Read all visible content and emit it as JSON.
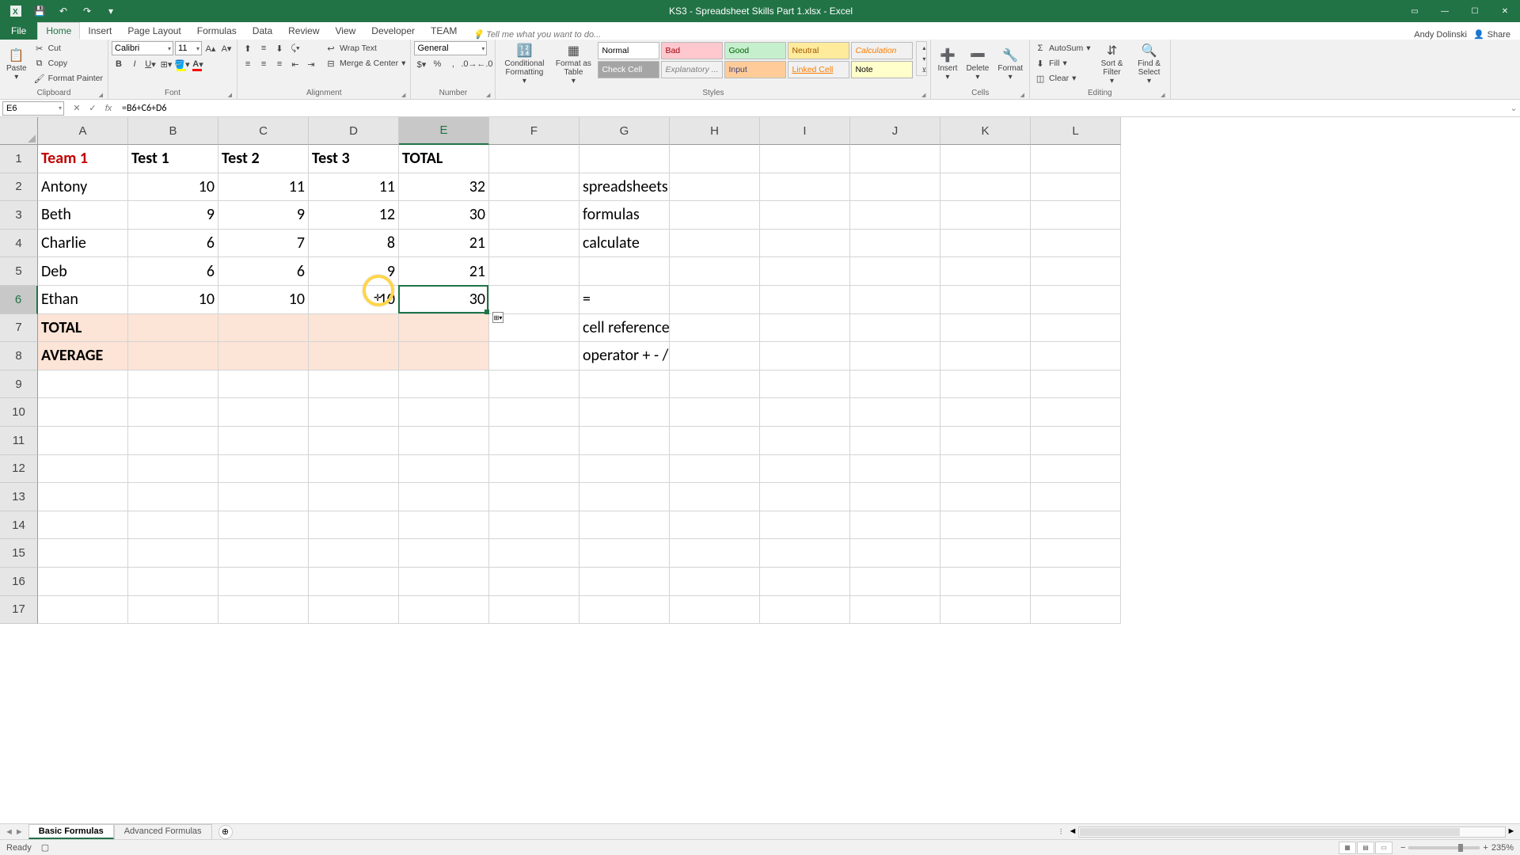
{
  "app": {
    "title": "KS3 - Spreadsheet Skills Part 1.xlsx - Excel",
    "user": "Andy Dolinski",
    "share": "Share"
  },
  "tabs": {
    "file": "File",
    "home": "Home",
    "insert": "Insert",
    "page": "Page Layout",
    "formulas": "Formulas",
    "data": "Data",
    "review": "Review",
    "view": "View",
    "dev": "Developer",
    "team": "TEAM",
    "tell": "Tell me what you want to do..."
  },
  "ribbon": {
    "clipboard": {
      "label": "Clipboard",
      "paste": "Paste",
      "cut": "Cut",
      "copy": "Copy",
      "painter": "Format Painter"
    },
    "font": {
      "label": "Font",
      "name": "Calibri",
      "size": "11"
    },
    "alignment": {
      "label": "Alignment",
      "wrap": "Wrap Text",
      "merge": "Merge & Center"
    },
    "number": {
      "label": "Number",
      "format": "General"
    },
    "styles": {
      "label": "Styles",
      "cond": "Conditional Formatting",
      "table": "Format as Table",
      "items": {
        "normal": "Normal",
        "bad": "Bad",
        "good": "Good",
        "neutral": "Neutral",
        "calc": "Calculation",
        "check": "Check Cell",
        "expl": "Explanatory ...",
        "input": "Input",
        "linked": "Linked Cell",
        "note": "Note"
      }
    },
    "cells": {
      "label": "Cells",
      "insert": "Insert",
      "delete": "Delete",
      "format": "Format"
    },
    "editing": {
      "label": "Editing",
      "autosum": "AutoSum",
      "fill": "Fill",
      "clear": "Clear",
      "sort": "Sort & Filter",
      "find": "Find & Select"
    }
  },
  "formula_bar": {
    "name": "E6",
    "formula": "=B6+C6+D6"
  },
  "grid": {
    "col_widths": {
      "A": 114,
      "B": 114,
      "C": 114,
      "D": 114,
      "E": 114,
      "F": 114,
      "G": 114,
      "H": 114,
      "I": 114,
      "J": 114,
      "K": 114,
      "L": 114
    },
    "cols": [
      "A",
      "B",
      "C",
      "D",
      "E",
      "F",
      "G",
      "H",
      "I",
      "J",
      "K",
      "L"
    ],
    "rows": 17,
    "selected": {
      "row": 6,
      "col": "E"
    },
    "data": {
      "A1": "Team 1",
      "B1": "Test 1",
      "C1": "Test 2",
      "D1": "Test 3",
      "E1": "TOTAL",
      "A2": "Antony",
      "B2": "10",
      "C2": "11",
      "D2": "11",
      "E2": "32",
      "G2": "spreadsheets",
      "A3": "Beth",
      "B3": "9",
      "C3": "9",
      "D3": "12",
      "E3": "30",
      "G3": "formulas",
      "A4": "Charlie",
      "B4": "6",
      "C4": "7",
      "D4": "8",
      "E4": "21",
      "G4": "calculate",
      "A5": "Deb",
      "B5": "6",
      "C5": "6",
      "D5": "9",
      "E5": "21",
      "A6": "Ethan",
      "B6": "10",
      "C6": "10",
      "D6": "10",
      "E6": "30",
      "G6": "=",
      "A7": "TOTAL",
      "G7": "cell references",
      "A8": "AVERAGE",
      "G8": "operator +  -  /  *"
    },
    "styles_map": {
      "A1": "b red",
      "B1": "b",
      "C1": "b",
      "D1": "b",
      "E1": "b",
      "A7": "b peach",
      "B7": "peach",
      "C7": "peach",
      "D7": "peach",
      "E7": "peach",
      "A8": "b peach",
      "B8": "peach",
      "C8": "peach",
      "D8": "peach",
      "E8": "peach"
    },
    "numeric_cols": [
      "B",
      "C",
      "D",
      "E"
    ]
  },
  "sheets": {
    "tabs": [
      "Basic Formulas",
      "Advanced Formulas"
    ],
    "active": 0
  },
  "status": {
    "ready": "Ready",
    "zoom": "235%"
  }
}
